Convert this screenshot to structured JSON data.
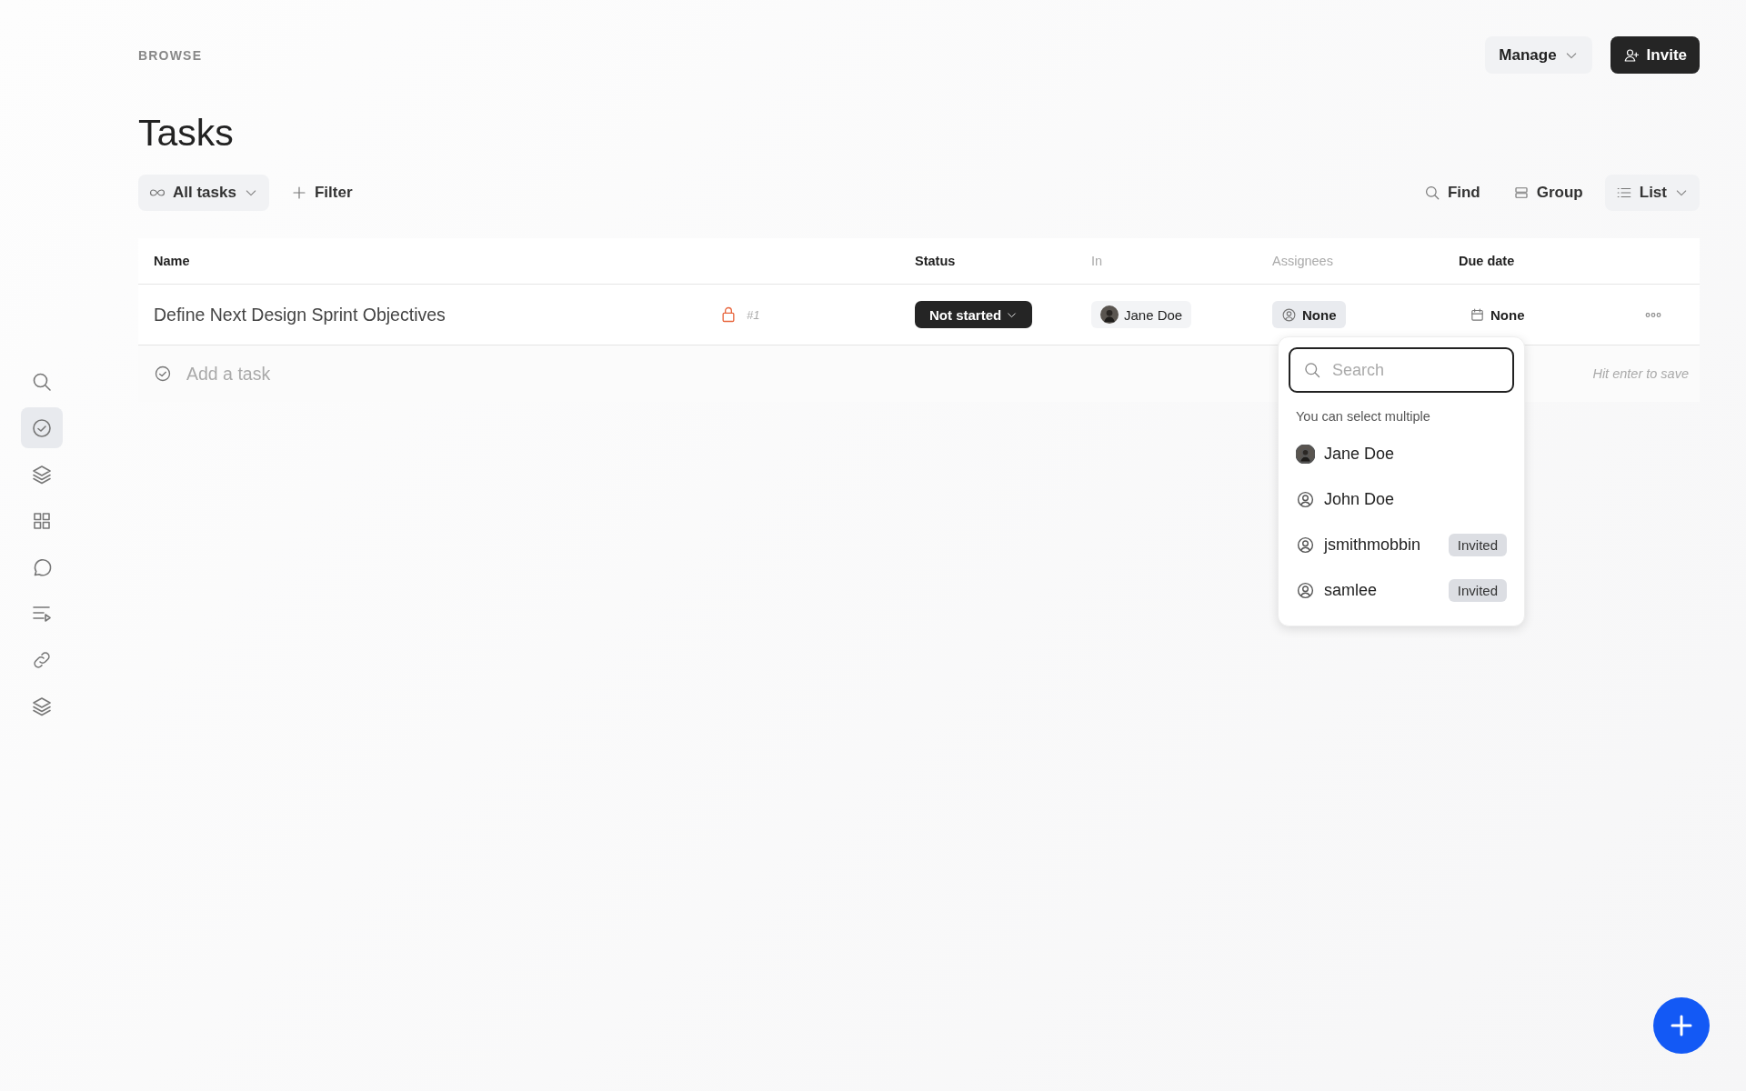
{
  "sidebar": {
    "items": [
      {
        "selected": false
      },
      {
        "selected": true
      },
      {
        "selected": false
      },
      {
        "selected": false
      },
      {
        "selected": false
      },
      {
        "selected": false
      },
      {
        "selected": false
      },
      {
        "selected": false
      }
    ]
  },
  "header": {
    "breadcrumb": "BROWSE",
    "title": "Tasks",
    "buttons": [
      {
        "label": "Manage",
        "kind": "menu"
      },
      {
        "label": "Invite",
        "kind": "primary"
      }
    ]
  },
  "toolbar": {
    "view_selector": "All tasks",
    "filter": "Filter",
    "find": "Find",
    "group": "Group",
    "layout": "List"
  },
  "table": {
    "columns": [
      {
        "label": "Name",
        "active": true
      },
      {
        "label": "Status",
        "active": true
      },
      {
        "label": "In",
        "active": false
      },
      {
        "label": "Assignees",
        "active": false
      },
      {
        "label": "Due date",
        "active": true
      }
    ],
    "rows": [
      {
        "name": "Define Next Design Sprint Objectives",
        "number": "#1",
        "status": "Not started",
        "in": "Jane Doe",
        "assignees": "None",
        "due_date": "None"
      }
    ],
    "add_task": {
      "placeholder": "Add a task",
      "hint": "Hit enter to save"
    }
  },
  "assignee_dropdown": {
    "search_placeholder": "Search",
    "note": "You can select multiple",
    "options": [
      {
        "name": "Jane Doe",
        "kind": "photo"
      },
      {
        "name": "John Doe",
        "kind": "user"
      },
      {
        "name": "jsmithmobbin",
        "kind": "user",
        "badge": "Invited"
      },
      {
        "name": "samlee",
        "kind": "user",
        "badge": "Invited"
      }
    ]
  }
}
